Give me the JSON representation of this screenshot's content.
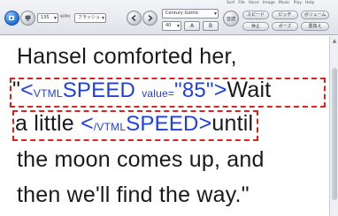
{
  "menu_strip": [
    "Sort",
    "File",
    "Voice",
    "Image",
    "Music",
    "Play",
    "Help"
  ],
  "toolbar": {
    "speed_value": "135",
    "speed_unit": "WPM",
    "voice_select": "フラッシュ",
    "font_name": "Century Gothic",
    "font_size": "40",
    "color_a": "A",
    "color_b": "B",
    "speak_button": "音読",
    "speed_button": "スピード",
    "pitch_button": "ピッチ",
    "volume_button": "ボリューム",
    "pause_button": "休止",
    "pose_button": "ポーズ",
    "replace_button": "置換え"
  },
  "document": {
    "line1": "Hansel comforted her,",
    "line2": {
      "open_quote": "\"",
      "lt": "<",
      "tag_prefix": "VTML",
      "tag_name": "SPEED",
      "attr_name": "value=",
      "attr_value": "\"85\"",
      "gt": ">",
      "trailing_text": "Wait"
    },
    "line3": {
      "leading_text": "a little ",
      "lt": "<",
      "tag_prefix": "/VTML",
      "tag_name": "SPEED",
      "gt": ">",
      "trailing_text": "until"
    },
    "line4": "the moon comes up, and",
    "line5": "then we'll find the way.\""
  },
  "colors": {
    "tag_text": "#1f3fe0",
    "highlight_dash": "#e0201c",
    "body_text": "#1a1a1a"
  },
  "icons": [
    "play-icon",
    "voice-icon",
    "back-icon",
    "forward-icon"
  ]
}
